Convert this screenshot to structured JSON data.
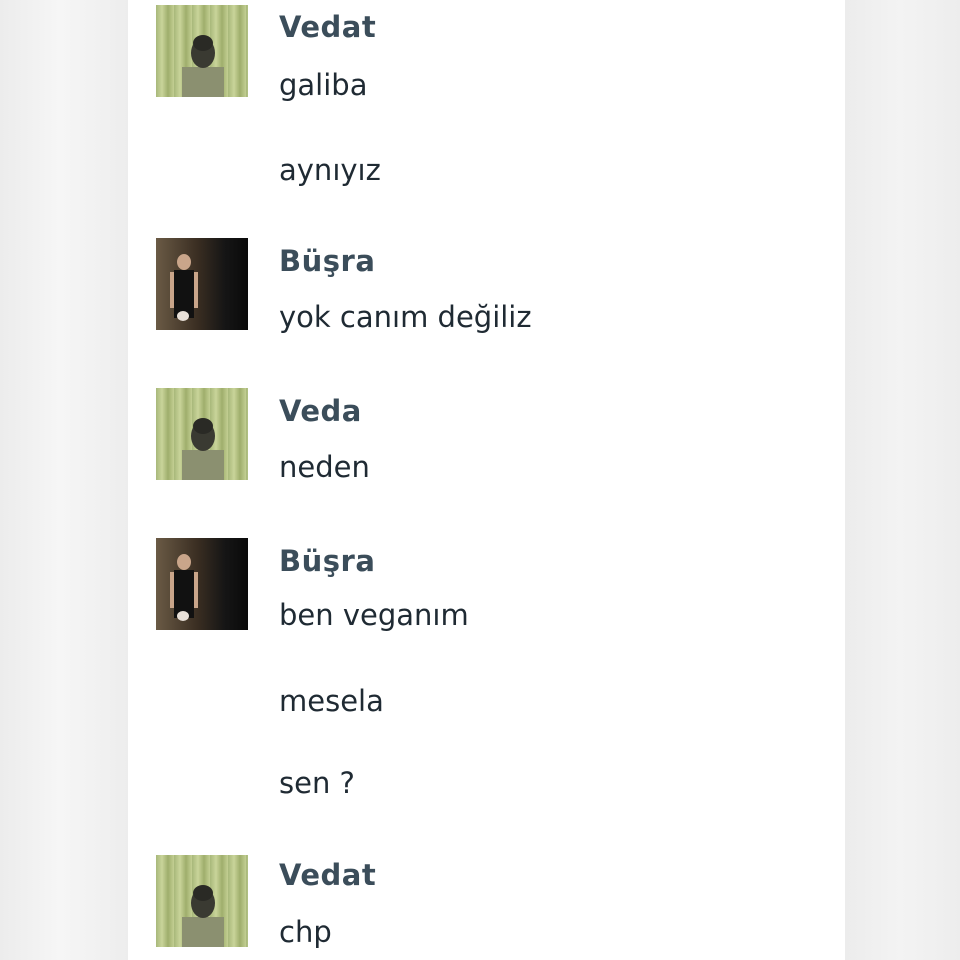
{
  "chat": {
    "entries": [
      {
        "sender": "Vedat",
        "messages": [
          "galiba",
          "aynıyız"
        ]
      },
      {
        "sender": "Büşra",
        "messages": [
          "yok canım değiliz"
        ]
      },
      {
        "sender": "Veda",
        "messages": [
          "neden"
        ]
      },
      {
        "sender": "Büşra",
        "messages": [
          "ben veganım",
          "mesela",
          "sen ?"
        ]
      },
      {
        "sender": "Vedat",
        "messages": [
          "chp"
        ]
      }
    ]
  },
  "colors": {
    "sender_name": "#3b4d5a",
    "message_text": "#1f2a33",
    "panel_background": "#ffffff",
    "side_background": "#ececec"
  },
  "icons": {
    "vedat_avatar": "man-portrait-icon",
    "busra_avatar": "woman-portrait-icon"
  }
}
